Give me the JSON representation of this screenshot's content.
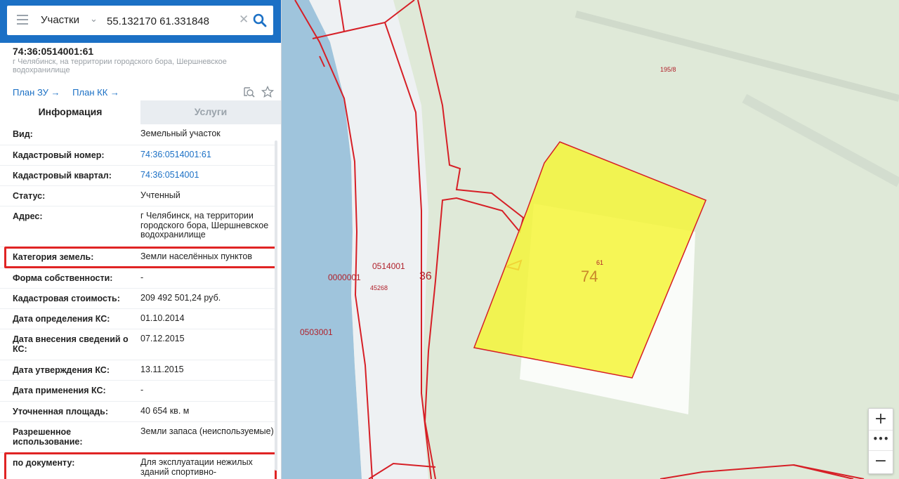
{
  "search": {
    "type_label": "Участки",
    "query": "55.132170 61.331848",
    "clear_glyph": "✕",
    "chevron_glyph": "⌄",
    "collapse_glyph": "‹"
  },
  "parcel": {
    "id": "74:36:0514001:61",
    "address": "г Челябинск, на территории городского бора, Шершневское водохранилище",
    "links": [
      "План ЗУ",
      "План КК"
    ]
  },
  "tabs": [
    {
      "label": "Информация",
      "active": true
    },
    {
      "label": "Услуги",
      "active": false
    }
  ],
  "rows": [
    {
      "key": "Вид:",
      "value": "Земельный участок"
    },
    {
      "key": "Кадастровый номер:",
      "value": "74:36:0514001:61",
      "link": true
    },
    {
      "key": "Кадастровый квартал:",
      "value": "74:36:0514001",
      "link": true
    },
    {
      "key": "Статус:",
      "value": "Учтенный"
    },
    {
      "key": "Адрес:",
      "value": "г Челябинск, на территории городского бора, Шершневское водохранилище"
    },
    {
      "key": "Категория земель:",
      "value": "Земли населённых пунктов",
      "highlight": true
    },
    {
      "key": "Форма собственности:",
      "value": "-"
    },
    {
      "key": "Кадастровая стоимость:",
      "value": "209 492 501,24 руб."
    },
    {
      "key": "Дата определения КС:",
      "value": "01.10.2014"
    },
    {
      "key": "Дата внесения сведений о КС:",
      "value": "07.12.2015"
    },
    {
      "key": "Дата утверждения КС:",
      "value": "13.11.2015"
    },
    {
      "key": "Дата применения КС:",
      "value": "-"
    },
    {
      "key": "Уточненная площадь:",
      "value": "40 654 кв. м"
    },
    {
      "key": "Разрешенное использование:",
      "value": "Земли запаса (неиспользуемые)"
    },
    {
      "key": "по документу:",
      "value": "Для эксплуатации нежилых зданий спортивно-оздоровительного центра",
      "highlight": true
    }
  ],
  "map": {
    "labels": {
      "block_a": "0514001",
      "block_b": "0000001",
      "block_c": "0503001",
      "district": "36",
      "parcel_big": "74",
      "parcel_small": "61",
      "num_45268": "45268",
      "num_195_8": "195/8"
    },
    "colors": {
      "boundary": "#d61f26",
      "parcel_fill": "#f4f53a",
      "water": "#9fc4dc",
      "land": "#dfe9d8"
    }
  },
  "zoom": {
    "plus": "+",
    "more": "•••",
    "minus": "−"
  }
}
